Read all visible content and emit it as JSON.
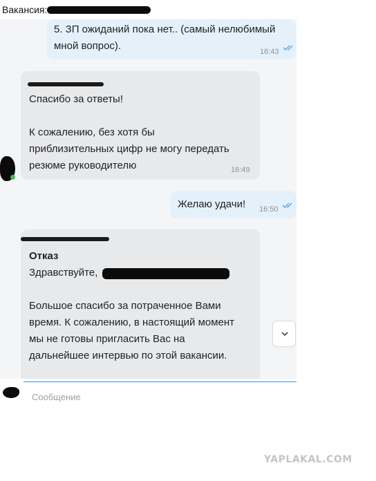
{
  "header": {
    "vacancy_label": "Вакансия:"
  },
  "messages": [
    {
      "direction": "out",
      "text": "5. ЗП ожиданий пока нет.. (самый нелюбимый\nмной вопрос).",
      "time": "16:43",
      "status": "read"
    },
    {
      "direction": "in",
      "text": "Спасибо за ответы!\n\nК сожалению, без хотя бы\nприблизительных цифр не могу передать\nрезюме руководителю",
      "time": "16:49"
    },
    {
      "direction": "out",
      "text": "Желаю удачи!",
      "time": "16:50",
      "status": "read"
    },
    {
      "direction": "in",
      "subject": "Отказ",
      "greeting": "Здравствуйте,",
      "text": "Большое спасибо за потраченное Вами\nвремя. К сожалению, в настоящий момент\nмы не готовы пригласить Вас на\nдальнейшее интервью по этой вакансии."
    }
  ],
  "composer": {
    "placeholder": "Сообщение"
  },
  "icons": {
    "scroll_down": "chevron-down-icon",
    "read_status": "double-check-icon"
  },
  "colors": {
    "outgoing_bubble": "#e4f1fb",
    "incoming_bubble": "#e8e9eb",
    "accent": "#3c8fd4",
    "online": "#3fbf5a"
  },
  "watermark": "YAPLAKAL.COM"
}
